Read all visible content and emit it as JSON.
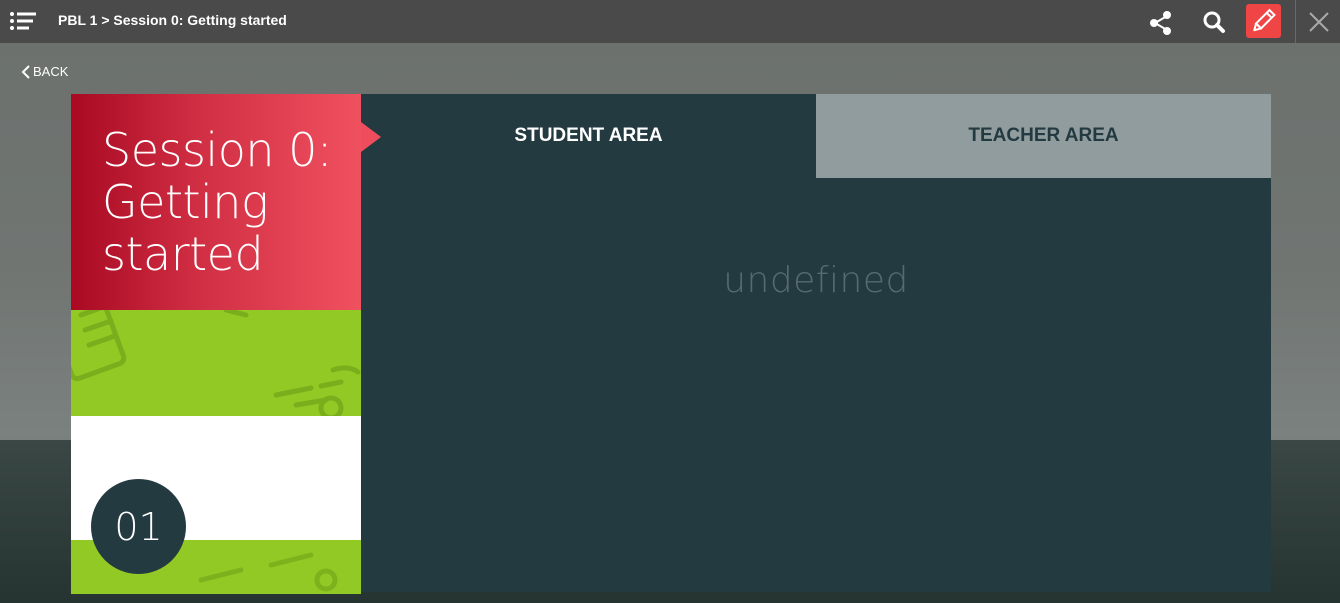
{
  "topbar": {
    "breadcrumb": "PBL 1 > Session 0: Getting started",
    "menu_icon": "list-icon",
    "share_icon": "share-icon",
    "search_icon": "search-icon",
    "edit_icon": "pencil-icon",
    "close_icon": "close-icon",
    "edit_color": "#ef4545"
  },
  "nav": {
    "back_label": "BACK"
  },
  "session": {
    "title": "Session 0: Getting started",
    "number": "01",
    "title_color": "#d12f44",
    "accent_green": "#93c924"
  },
  "tabs": [
    {
      "label": "STUDENT AREA",
      "active": true
    },
    {
      "label": "TEACHER AREA",
      "active": false
    }
  ],
  "content": {
    "text": "undefined"
  }
}
